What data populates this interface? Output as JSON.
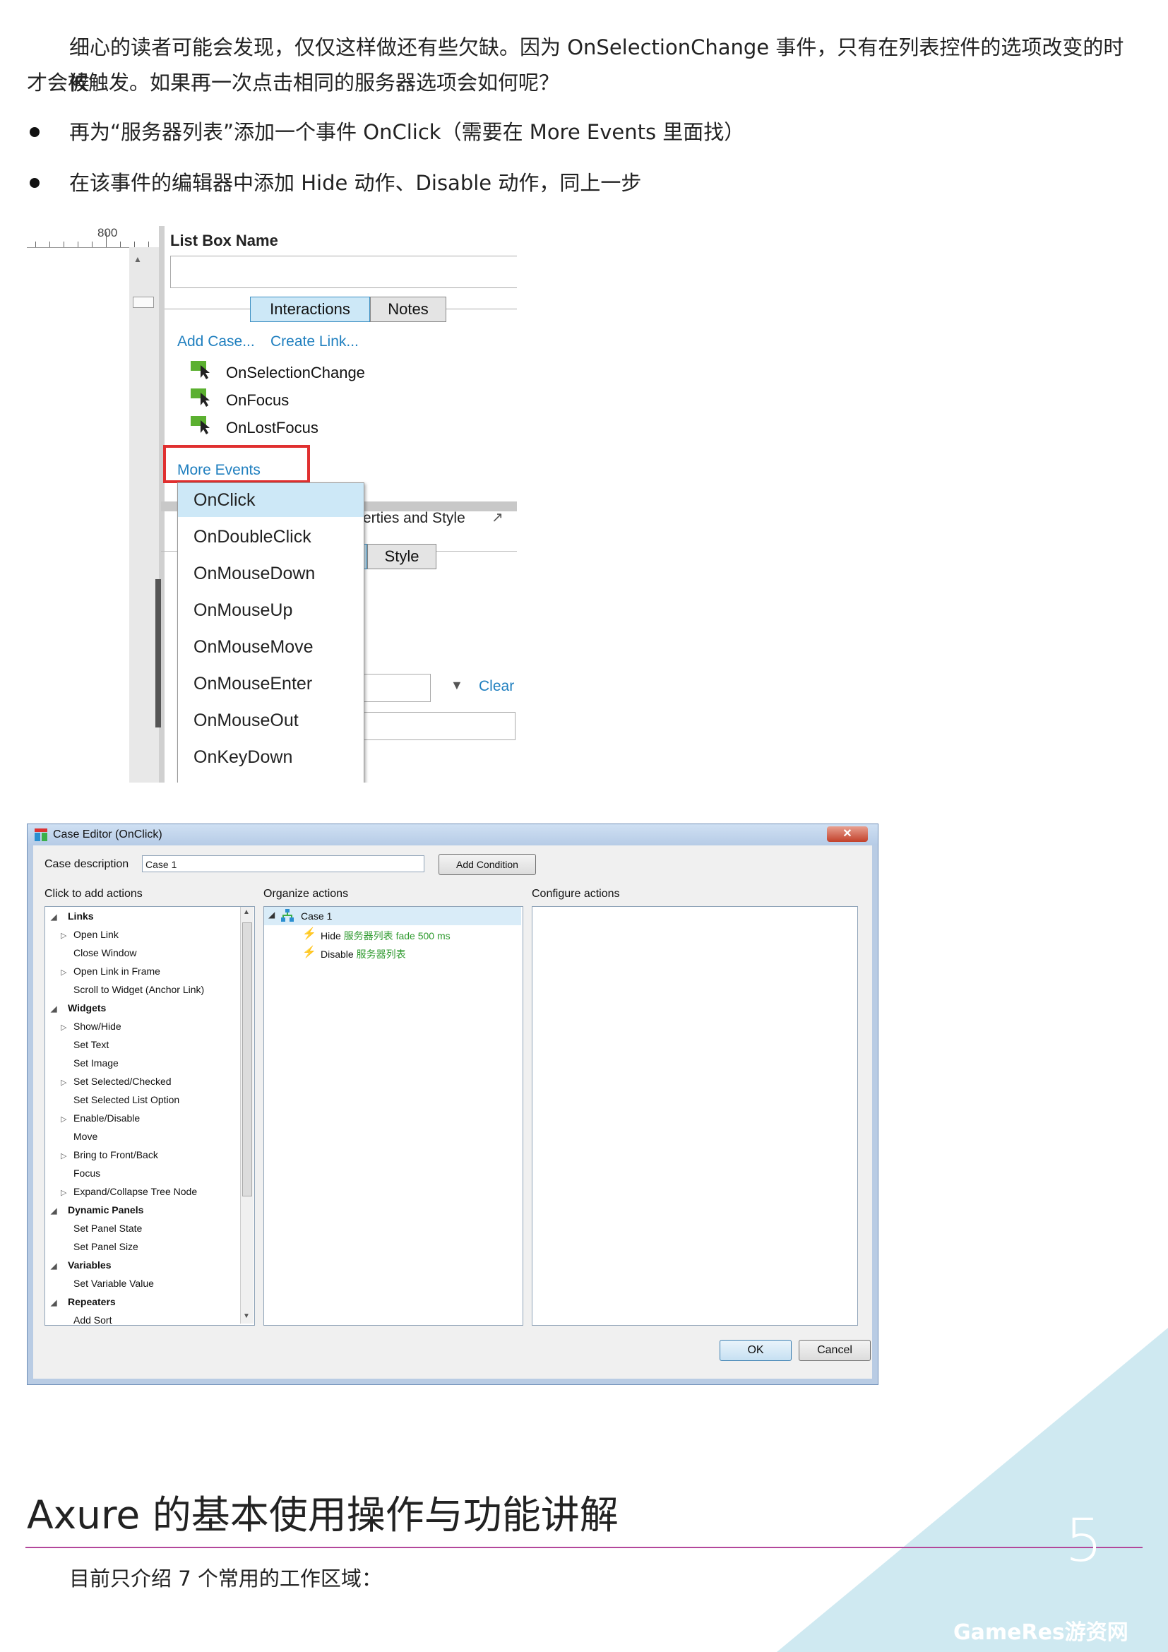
{
  "intro": {
    "line1": "细心的读者可能会发现，仅仅这样做还有些欠缺。因为 OnSelectionChange 事件，只有在列表控件的选项改变的时候",
    "line2": "才会被触发。如果再一次点击相同的服务器选项会如何呢？"
  },
  "bullets": [
    "再为“服务器列表”添加一个事件 OnClick（需要在 More Events 里面找）",
    "在该事件的编辑器中添加 Hide 动作、Disable 动作，同上一步"
  ],
  "shot1": {
    "ruler_label": "800",
    "list_box_name_label": "List Box Name",
    "tabs": [
      "Interactions",
      "Notes"
    ],
    "add_case": "Add Case...",
    "create_link": "Create Link...",
    "events": [
      "OnSelectionChange",
      "OnFocus",
      "OnLostFocus"
    ],
    "more_events": "More Events",
    "props_partial": "erties and Style",
    "tab_partial": "s",
    "style_tab": "Style",
    "clear": "Clear",
    "dropdown": [
      "OnClick",
      "OnDoubleClick",
      "OnMouseDown",
      "OnMouseUp",
      "OnMouseMove",
      "OnMouseEnter",
      "OnMouseOut",
      "OnKeyDown"
    ],
    "colors": {
      "highlight_box": "#e03030",
      "link": "#1f7fbf",
      "tab_active": "#cde8f7",
      "selected_item": "#cde8f7"
    }
  },
  "case_editor": {
    "title": "Case Editor (OnClick)",
    "case_description_label": "Case description",
    "case_description_value": "Case 1",
    "add_condition": "Add Condition",
    "click_to_add": "Click to add actions",
    "organize": "Organize actions",
    "configure": "Configure actions",
    "tree": [
      {
        "label": "Links",
        "group": true
      },
      {
        "label": "Open Link",
        "arrow": true
      },
      {
        "label": "Close Window"
      },
      {
        "label": "Open Link in Frame",
        "arrow": true
      },
      {
        "label": "Scroll to Widget (Anchor Link)"
      },
      {
        "label": "Widgets",
        "group": true
      },
      {
        "label": "Show/Hide",
        "arrow": true
      },
      {
        "label": "Set Text"
      },
      {
        "label": "Set Image"
      },
      {
        "label": "Set Selected/Checked",
        "arrow": true
      },
      {
        "label": "Set Selected List Option"
      },
      {
        "label": "Enable/Disable",
        "arrow": true
      },
      {
        "label": "Move"
      },
      {
        "label": "Bring to Front/Back",
        "arrow": true
      },
      {
        "label": "Focus"
      },
      {
        "label": "Expand/Collapse Tree Node",
        "arrow": true
      },
      {
        "label": "Dynamic Panels",
        "group": true
      },
      {
        "label": "Set Panel State"
      },
      {
        "label": "Set Panel Size"
      },
      {
        "label": "Variables",
        "group": true
      },
      {
        "label": "Set Variable Value"
      },
      {
        "label": "Repeaters",
        "group": true
      },
      {
        "label": "Add Sort"
      }
    ],
    "case_node": "Case 1",
    "actions": [
      {
        "verb": "Hide",
        "detail": "服务器列表 fade 500 ms"
      },
      {
        "verb": "Disable",
        "detail": "服务器列表"
      }
    ],
    "ok": "OK",
    "cancel": "Cancel"
  },
  "section": {
    "title": "Axure 的基本使用操作与功能讲解",
    "body": "目前只介绍 7 个常用的工作区域：",
    "page_number": "5",
    "watermark": "GameRes游资网",
    "colors": {
      "rule": "#b3479b",
      "corner": "#cfe9f1"
    }
  }
}
